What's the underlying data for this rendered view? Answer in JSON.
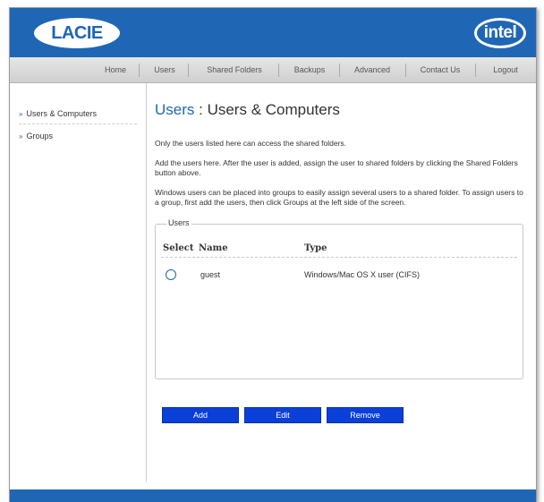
{
  "brand": {
    "lacie_logo_text": "LACIE",
    "intel_logo_text": "intel"
  },
  "nav": {
    "items": [
      {
        "label": "Home"
      },
      {
        "label": "Users"
      },
      {
        "label": "Shared Folders"
      },
      {
        "label": "Backups"
      },
      {
        "label": "Advanced"
      },
      {
        "label": "Contact Us"
      },
      {
        "label": "Logout"
      }
    ]
  },
  "sidebar": {
    "items": [
      {
        "label": "Users & Computers"
      },
      {
        "label": "Groups"
      }
    ]
  },
  "page": {
    "title_crumb": "Users",
    "title_separator": " : ",
    "title": "Users & Computers",
    "paragraphs": [
      "Only the users listed here can access the shared folders.",
      "Add the users here. After the user is added, assign the user to shared folders by clicking the Shared Folders button above.",
      "Windows users can be placed into groups to easily assign several users to a shared folder. To assign users to a group, first add the users, then click Groups at the left side of the screen."
    ]
  },
  "users_table": {
    "legend": "Users",
    "columns": {
      "select": "Select",
      "name": "Name",
      "type": "Type"
    },
    "rows": [
      {
        "name": "guest",
        "type": "Windows/Mac OS X user (CIFS)"
      }
    ]
  },
  "buttons": {
    "add": "Add",
    "edit": "Edit",
    "remove": "Remove"
  },
  "colors": {
    "brand_blue": "#1f66b5",
    "button_blue": "#0a3fd8",
    "nav_gray": "#d9d9d9"
  }
}
